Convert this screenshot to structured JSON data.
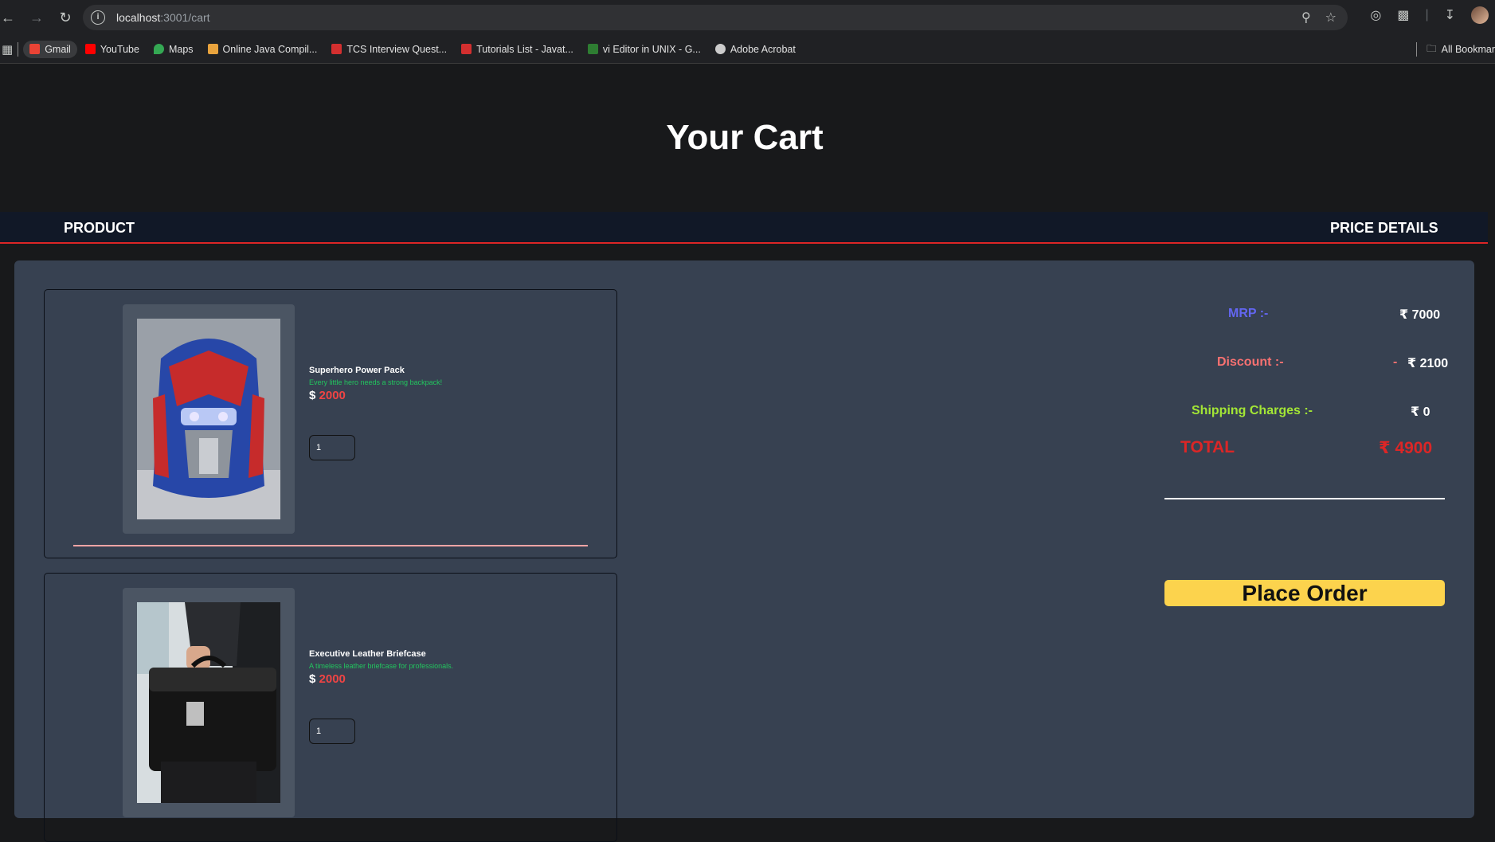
{
  "browser": {
    "url_host": "localhost",
    "url_path": ":3001/cart",
    "bookmarks": [
      {
        "label": "Gmail",
        "color": "#ea4335"
      },
      {
        "label": "YouTube",
        "color": "#ff0000"
      },
      {
        "label": "Maps",
        "color": "#34a853"
      },
      {
        "label": "Online Java Compil...",
        "color": "#e8a33d"
      },
      {
        "label": "TCS Interview Quest...",
        "color": "#d32f2f"
      },
      {
        "label": "Tutorials List - Javat...",
        "color": "#d32f2f"
      },
      {
        "label": "vi Editor in UNIX - G...",
        "color": "#2e7d32"
      },
      {
        "label": "Adobe Acrobat",
        "color": "#cccccc"
      }
    ],
    "all_bookmarks": "All Bookmar"
  },
  "page": {
    "title": "Your Cart",
    "header_left": "PRODUCT",
    "header_right": "PRICE DETAILS"
  },
  "products": [
    {
      "name": "Superhero Power Pack",
      "description": "Every little hero needs a strong backpack!",
      "currency": "$",
      "price": "2000",
      "quantity": "1"
    },
    {
      "name": "Executive Leather Briefcase",
      "description": "A timeless leather briefcase for professionals.",
      "currency": "$",
      "price": "2000",
      "quantity": "1"
    }
  ],
  "price_details": {
    "mrp_label": "MRP :-",
    "mrp_value": "₹ 7000",
    "discount_label": "Discount :-",
    "discount_sign": "-",
    "discount_value": "₹ 2100",
    "shipping_label": "Shipping Charges :-",
    "shipping_value": "₹ 0",
    "total_label": "TOTAL",
    "total_value": "₹ 4900",
    "place_order": "Place Order"
  },
  "colors": {
    "mrp_label": "#6366f1",
    "discount_label": "#f87171",
    "shipping_label": "#a3e635",
    "total": "#dc2626",
    "button": "#fcd34d"
  }
}
